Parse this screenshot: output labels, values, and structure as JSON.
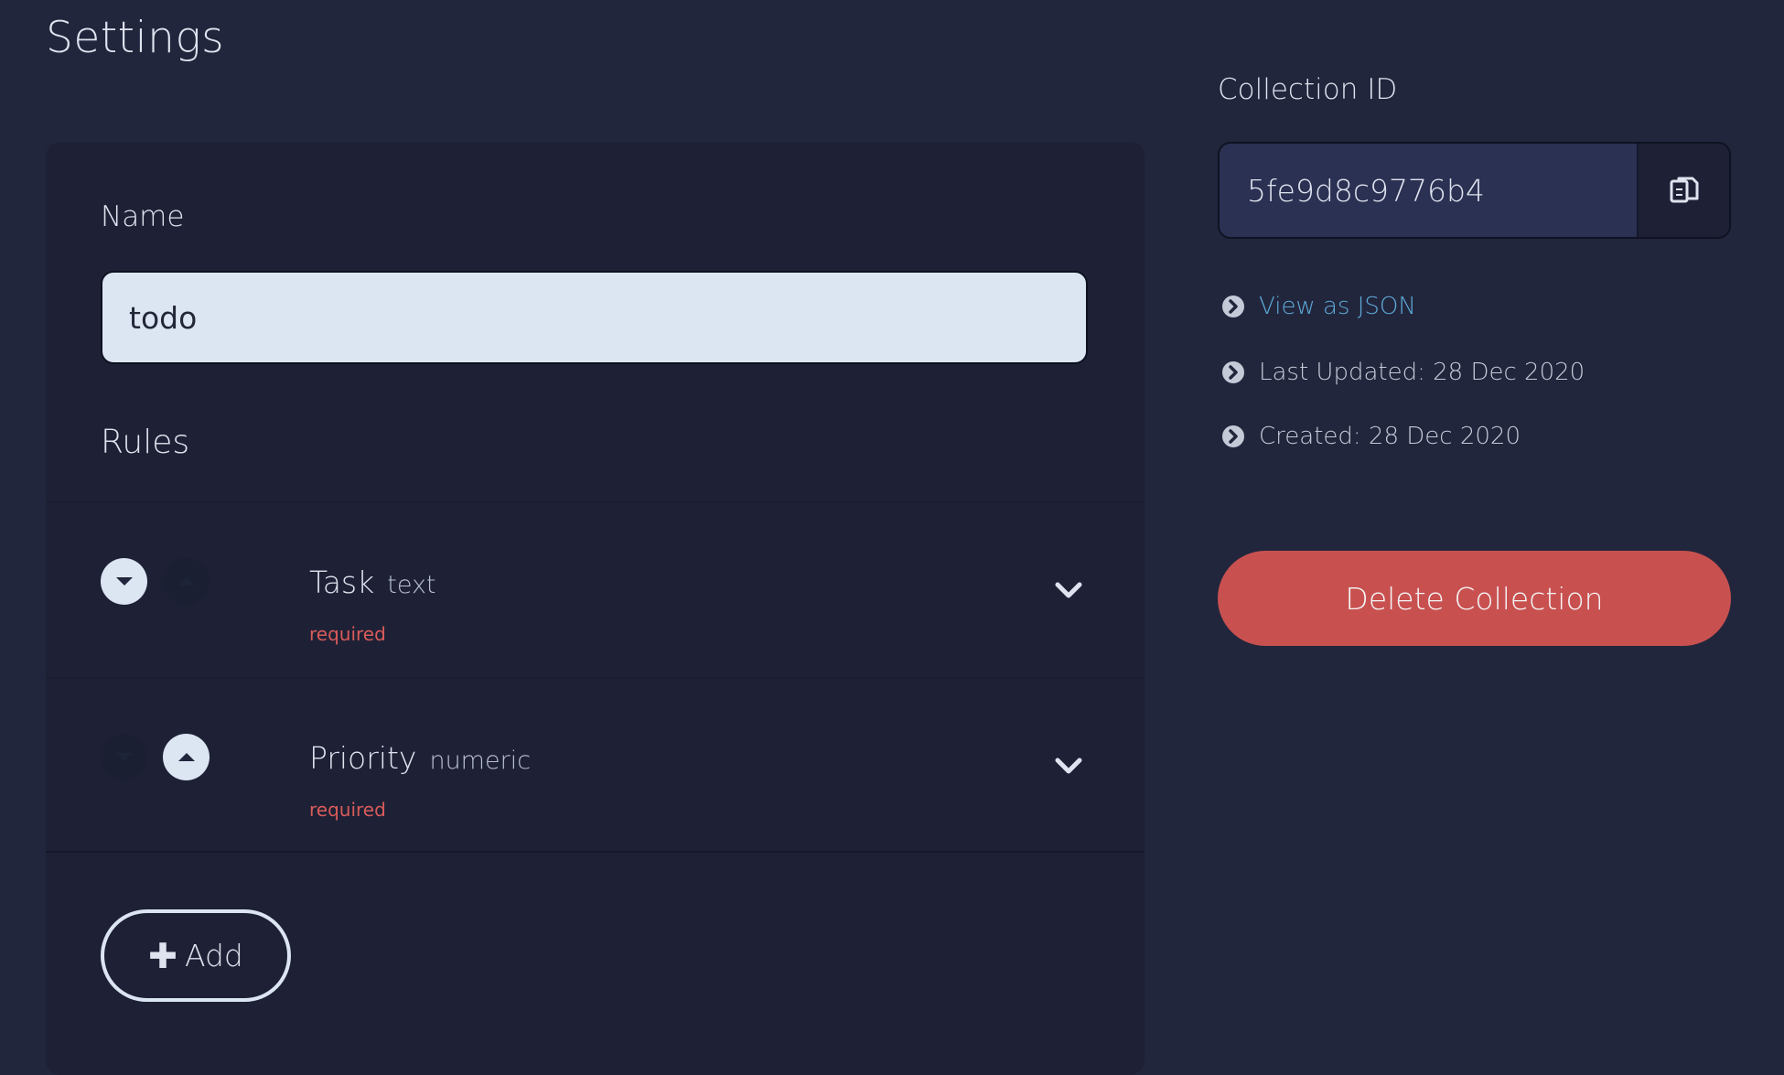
{
  "page": {
    "title": "Settings"
  },
  "form": {
    "name_label": "Name",
    "name_value": "todo",
    "rules_title": "Rules",
    "rules": [
      {
        "name": "Task",
        "type": "text",
        "required": "required"
      },
      {
        "name": "Priority",
        "type": "numeric",
        "required": "required"
      }
    ],
    "add_label": "Add"
  },
  "sidebar": {
    "collection_id_label": "Collection ID",
    "collection_id": "5fe9d8c9776b4",
    "view_json": "View as JSON",
    "last_updated": "Last Updated: 28 Dec 2020",
    "created": "Created: 28 Dec 2020",
    "delete_label": "Delete Collection"
  },
  "colors": {
    "background": "#22263c",
    "card": "#1e2135",
    "input": "#dce6f3",
    "danger": "#c85150",
    "link": "#5ea8d8"
  },
  "icons": [
    "copy-icon",
    "chevron-circle-right-icon",
    "chevron-down-icon",
    "caret-down-icon",
    "caret-up-icon",
    "plus-icon"
  ]
}
